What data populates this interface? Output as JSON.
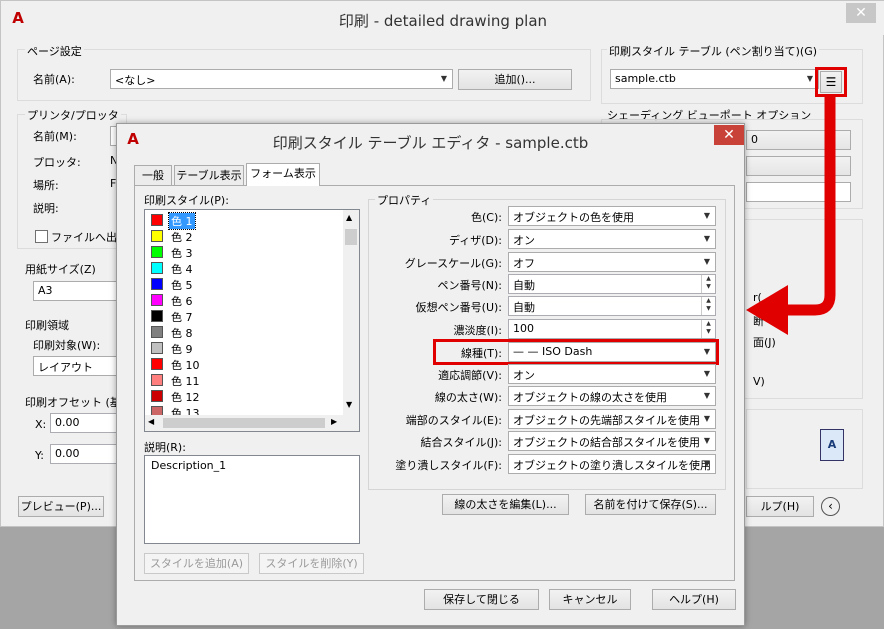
{
  "main": {
    "title": "印刷 - detailed drawing plan",
    "close": "✕",
    "page_setup": {
      "group": "ページ設定",
      "name_label": "名前(A):",
      "name_value": "<なし>",
      "add_button": "追加()..."
    },
    "printer": {
      "group": "プリンタ/プロッタ",
      "name_label": "名前(M):",
      "plotter_label": "プロッタ:",
      "plotter_value": "N",
      "location_label": "場所:",
      "location_value": "F",
      "desc_label": "説明:",
      "file_output": "ファイルへ出力"
    },
    "paper": {
      "group": "用紙サイズ(Z)",
      "value": "A3"
    },
    "area": {
      "group": "印刷領域",
      "target_label": "印刷対象(W):",
      "target_value": "レイアウト"
    },
    "offset": {
      "group": "印刷オフセット (基",
      "x_label": "X:",
      "x_value": "0.00",
      "y_label": "Y:",
      "y_value": "0.00"
    },
    "preview_button": "プレビュー(P)...",
    "help_button": "ルプ(H)",
    "plot_style": {
      "group": "印刷スタイル テーブル (ペン割り当て)(G)",
      "value": "sample.ctb"
    },
    "shading": {
      "group": "シェーディング ビューポート オプション",
      "partial_1": "0"
    },
    "right_partial": [
      "r(",
      "断",
      "面(J)",
      "V)"
    ]
  },
  "editor": {
    "title": "印刷スタイル テーブル エディタ - sample.ctb",
    "close": "✕",
    "tabs": [
      "一般",
      "テーブル表示",
      "フォーム表示"
    ],
    "styles_label": "印刷スタイル(P):",
    "styles": [
      {
        "name": "色 1",
        "color": "#ff0000"
      },
      {
        "name": "色 2",
        "color": "#ffff00"
      },
      {
        "name": "色 3",
        "color": "#00ff00"
      },
      {
        "name": "色 4",
        "color": "#00ffff"
      },
      {
        "name": "色 5",
        "color": "#0000ff"
      },
      {
        "name": "色 6",
        "color": "#ff00ff"
      },
      {
        "name": "色 7",
        "color": "#000000"
      },
      {
        "name": "色 8",
        "color": "#808080"
      },
      {
        "name": "色 9",
        "color": "#c0c0c0"
      },
      {
        "name": "色 10",
        "color": "#ff0000"
      },
      {
        "name": "色 11",
        "color": "#ff7f7f"
      },
      {
        "name": "色 12",
        "color": "#cc0000"
      },
      {
        "name": "色 13",
        "color": "#cc6666"
      }
    ],
    "desc_label": "説明(R):",
    "desc_value": "Description_1",
    "add_style_button": "スタイルを追加(A)",
    "delete_style_button": "スタイルを削除(Y)",
    "properties_group": "プロパティ",
    "properties": [
      {
        "label": "色(C):",
        "value": "オブジェクトの色を使用",
        "kind": "combo"
      },
      {
        "label": "ディザ(D):",
        "value": "オン",
        "kind": "combo"
      },
      {
        "label": "グレースケール(G):",
        "value": "オフ",
        "kind": "combo"
      },
      {
        "label": "ペン番号(N):",
        "value": "自動",
        "kind": "spin"
      },
      {
        "label": "仮想ペン番号(U):",
        "value": "自動",
        "kind": "spin"
      },
      {
        "label": "濃淡度(I):",
        "value": "100",
        "kind": "spin"
      },
      {
        "label": "線種(T):",
        "value": "ISO Dash",
        "kind": "combo"
      },
      {
        "label": "適応調節(V):",
        "value": "オン",
        "kind": "combo"
      },
      {
        "label": "線の太さ(W):",
        "value": "オブジェクトの線の太さを使用",
        "kind": "combo"
      },
      {
        "label": "端部のスタイル(E):",
        "value": "オブジェクトの先端部スタイルを使用",
        "kind": "combo"
      },
      {
        "label": "結合スタイル(J):",
        "value": "オブジェクトの結合部スタイルを使用",
        "kind": "combo"
      },
      {
        "label": "塗り潰しスタイル(F):",
        "value": "オブジェクトの塗り潰しスタイルを使用",
        "kind": "combo"
      }
    ],
    "edit_lineweight_button": "線の太さを編集(L)...",
    "save_as_button": "名前を付けて保存(S)...",
    "save_close_button": "保存して閉じる",
    "cancel_button": "キャンセル",
    "help_button": "ヘルプ(H)"
  }
}
